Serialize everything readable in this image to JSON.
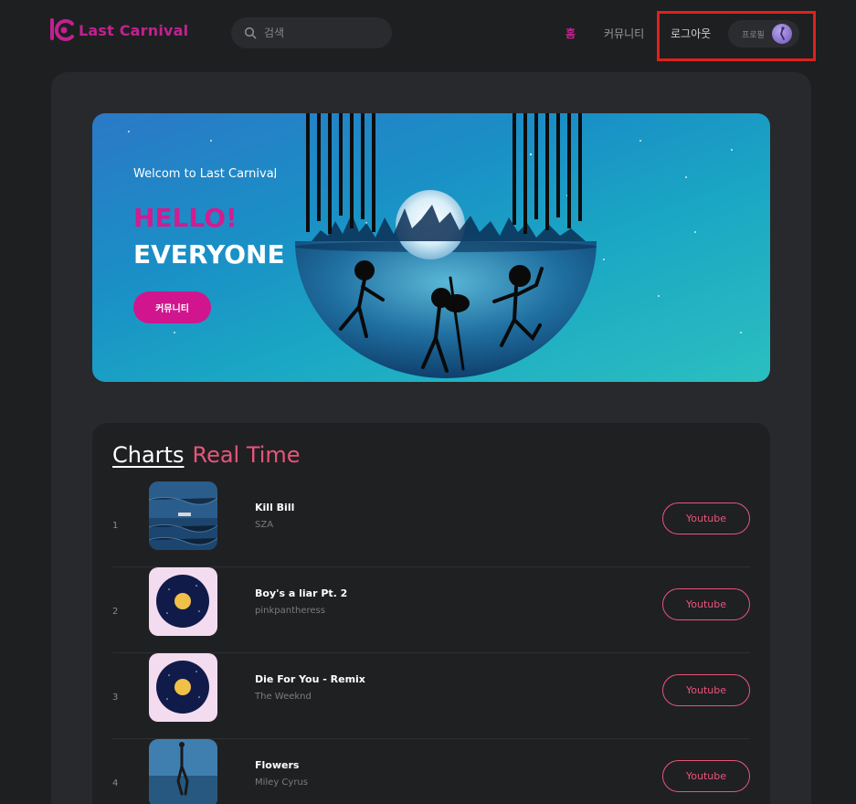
{
  "header": {
    "logo_text": "Last Carnival",
    "search_placeholder": "검색",
    "nav": {
      "home": "홈",
      "community": "커뮤니티",
      "logout": "로그아웃"
    },
    "profile_label": "프로필"
  },
  "hero": {
    "welcome": "Welcom to Last Carnival",
    "hello": "HELLO!",
    "everyone": "EVERYONE",
    "button_label": "커뮤니티"
  },
  "charts": {
    "title_part1": "Charts",
    "title_part2": "Real Time",
    "button_label": "Youtube",
    "rows": [
      {
        "rank": "1",
        "title": "Kill Bill",
        "artist": "SZA"
      },
      {
        "rank": "2",
        "title": "Boy's a liar Pt. 2",
        "artist": "pinkpantheress"
      },
      {
        "rank": "3",
        "title": "Die For You - Remix",
        "artist": "The Weeknd"
      },
      {
        "rank": "4",
        "title": "Flowers",
        "artist": "Miley Cyrus"
      }
    ]
  },
  "colors": {
    "brand": "#c2218f",
    "accent_pink": "#e8557a",
    "highlight_box": "#e0201c"
  }
}
